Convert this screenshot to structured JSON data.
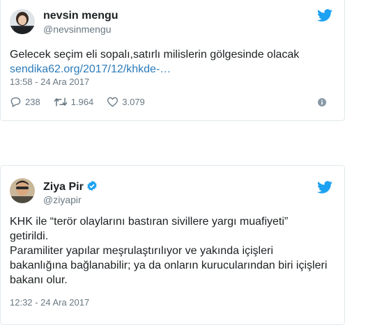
{
  "tweets": [
    {
      "name": "nevsin mengu",
      "handle": "@nevsinmengu",
      "text": "Gelecek seçim eli sopalı,satırlı milislerin gölgesinde olacak",
      "link": "sendika62.org/2017/12/khkde-…",
      "time": "13:58 - 24 Ara 2017",
      "replies": "238",
      "retweets": "1.964",
      "likes": "3.079"
    },
    {
      "name": "Ziya Pir",
      "handle": "@ziyapir",
      "verified": true,
      "lines": [
        "KHK ile “terör olaylarını bastıran sivillere yargı muafiyeti”",
        "getirildi.",
        "Paramiliter yapılar meşrulaştırılıyor ve yakında içişleri",
        "bakanlığına bağlanabilir; ya da onların kurucularından biri içişleri",
        "bakanı olur."
      ],
      "time": "12:32 - 24 Ara 2017"
    }
  ],
  "colors": {
    "twitter_blue": "#1da1f2",
    "link": "#2b7bb9",
    "muted": "#697882",
    "border": "#e1e8ed"
  },
  "icons": [
    "twitter-bird-icon",
    "reply-icon",
    "retweet-icon",
    "like-icon",
    "info-icon",
    "verified-badge-icon"
  ]
}
